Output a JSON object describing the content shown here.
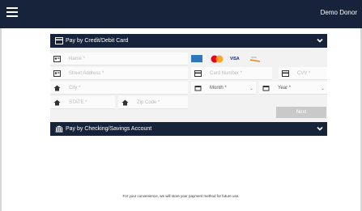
{
  "header": {
    "user_name": "Demo Donor"
  },
  "credit_panel": {
    "title": "Pay by Credit/Debit Card",
    "fields": {
      "name": "Name *",
      "street": "Street Address *",
      "city": "City *",
      "state": "STATE *",
      "zip": "Zip Code *",
      "card_number": "Card Number *",
      "cvv": "CVV *",
      "month": "Month *",
      "year": "Year *"
    },
    "next_label": "Next",
    "card_logos": [
      "amex-icon",
      "mastercard-icon",
      "visa-icon",
      "discover-icon"
    ]
  },
  "checking_panel": {
    "title": "Pay by Checking/Savings Account"
  },
  "footnote": "For your convenience, we will store your payment method for future use.",
  "colors": {
    "navy": "#16233b",
    "amex": "#2e77bc",
    "mastercard_red": "#eb001b",
    "mastercard_yellow": "#f79e1b",
    "visa": "#1a1f71",
    "discover": "#f58220"
  }
}
